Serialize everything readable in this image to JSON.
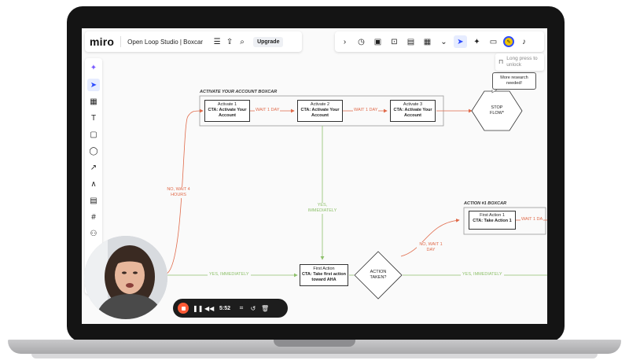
{
  "app": {
    "logo": "miro",
    "board_title": "Open Loop Studio | Boxcar",
    "upgrade_label": "Upgrade"
  },
  "lock_tip": {
    "text": "Long press to unlock"
  },
  "comment": {
    "text": "More research needed!"
  },
  "sections": {
    "activate": "ACTIVATE YOUR ACCOUNT BOXCAR",
    "action1": "ACTION #1 BOXCAR"
  },
  "nodes": {
    "activate1": {
      "title": "Activate 1",
      "cta": "CTA: Activate Your Account"
    },
    "activate2": {
      "title": "Activate 2",
      "cta": "CTA: Activate Your Account"
    },
    "activate3": {
      "title": "Activate 3",
      "cta": "CTA: Activate Your Account"
    },
    "stop": "STOP FLOW*",
    "first_action": {
      "title": "First Action",
      "cta": "CTA: Take first action toward AHA"
    },
    "action_taken": "ACTION TAKEN?",
    "first_action1": {
      "title": "First Action 1",
      "cta": "CTA: Take Action 1"
    }
  },
  "edges": {
    "wait1a": "WAIT 1 DAY",
    "wait1b": "WAIT 1 DAY",
    "wait1c": "WAIT 1 DA",
    "no_wait4": "NO, WAIT 4 HOURS",
    "yes_immediately_v": "YES, IMMEDIATELY",
    "yes_immediately_h": "YES, IMMEDIATELY",
    "yes_immediately_r": "YES, IMMEDIATELY",
    "no_wait1": "NO, WAIT 1 DAY"
  },
  "recorder": {
    "time": "5:52"
  },
  "colors": {
    "accent": "#2d4bff",
    "no_edge": "#e06a4a",
    "yes_edge": "#8fc16c",
    "record": "#ff5a36"
  }
}
